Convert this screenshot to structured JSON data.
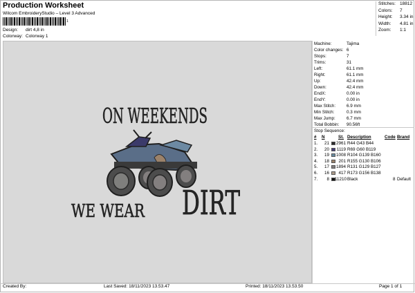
{
  "header": {
    "title": "Production Worksheet",
    "subtitle": "Wilcom EmbroideryStudio – Level 3 Advanced",
    "barcode_text": "1",
    "design_label": "Design:",
    "design_value": "dirt 4,8 in",
    "colorway_label": "Colorway:",
    "colorway_value": "Colorway 1"
  },
  "stats": [
    {
      "label": "Stitches:",
      "value": "18812"
    },
    {
      "label": "Colors:",
      "value": "7"
    },
    {
      "label": "Height:",
      "value": "3.34 in"
    },
    {
      "label": "Width:",
      "value": "4.81 in"
    },
    {
      "label": "Zoom:",
      "value": "1:1"
    }
  ],
  "machine_info": [
    {
      "label": "Machine:",
      "value": "Tajima"
    },
    {
      "label": "Color changes:",
      "value": "6"
    },
    {
      "label": "Stops:",
      "value": "7"
    },
    {
      "label": "Trims:",
      "value": "31"
    },
    {
      "label": "Left:",
      "value": "61.1 mm"
    },
    {
      "label": "Right:",
      "value": "61.1 mm"
    },
    {
      "label": "Up:",
      "value": "42.4 mm"
    },
    {
      "label": "Down:",
      "value": "42.4 mm"
    },
    {
      "label": "EndX:",
      "value": "0.00 in"
    },
    {
      "label": "EndY:",
      "value": "0.00 in"
    },
    {
      "label": "Max Stitch:",
      "value": "6.9 mm"
    },
    {
      "label": "Min Stitch:",
      "value": "0.3 mm"
    },
    {
      "label": "Max Jump:",
      "value": "6.7 mm"
    },
    {
      "label": "Total Bobbin:",
      "value": "90.56ft"
    }
  ],
  "sequence": {
    "title": "Stop Sequence:",
    "headers": {
      "num": "#",
      "n": "N",
      "st": "St.",
      "desc": "Description",
      "code": "Code",
      "brand": "Brand"
    },
    "rows": [
      {
        "num": "1.",
        "n": "21",
        "color": "#2c2b2c",
        "st": "2961",
        "desc": "R44 G43 B44",
        "code": "",
        "brand": ""
      },
      {
        "num": "2.",
        "n": "20",
        "color": "#453c77",
        "st": "1119",
        "desc": "R69 G60 B119",
        "code": "",
        "brand": ""
      },
      {
        "num": "3.",
        "n": "19",
        "color": "#688ba0",
        "st": "1008",
        "desc": "R104 G139 B160",
        "code": "",
        "brand": ""
      },
      {
        "num": "4.",
        "n": "18",
        "color": "#9b826a",
        "st": "201",
        "desc": "R155 G130 B106",
        "code": "",
        "brand": ""
      },
      {
        "num": "5.",
        "n": "17",
        "color": "#837f7f",
        "st": "1894",
        "desc": "R131 G129 B127",
        "code": "",
        "brand": ""
      },
      {
        "num": "6.",
        "n": "16",
        "color": "#ad9c8a",
        "st": "417",
        "desc": "R173 G156 B138",
        "code": "",
        "brand": ""
      },
      {
        "num": "7.",
        "n": "8",
        "color": "#111111",
        "st": "11210",
        "desc": "Black",
        "code": "8",
        "brand": "Default"
      }
    ]
  },
  "artwork": {
    "line1": "ON WEEKENDS",
    "line2a": "WE WEAR",
    "line2b": "DIRT"
  },
  "footer": {
    "created": "Created By:",
    "saved": "Last Saved: 18/11/2023 13.53.47",
    "printed": "Printed: 18/11/2023 13.53.50",
    "page": "Page 1 of 1"
  }
}
